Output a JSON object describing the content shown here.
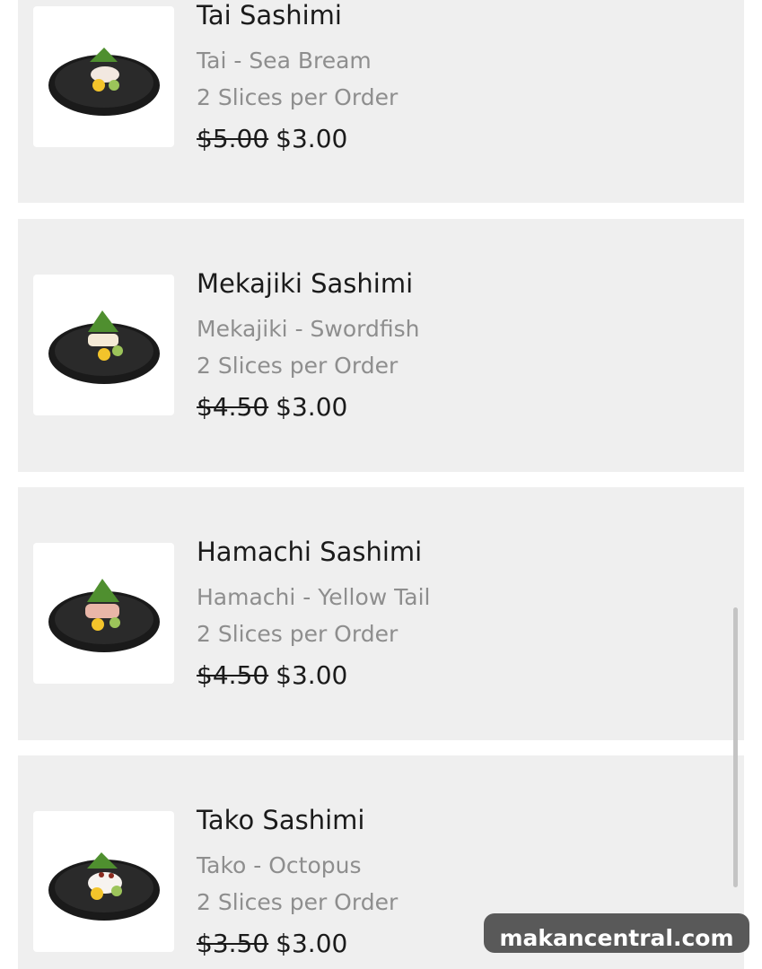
{
  "items": [
    {
      "name": "Tai Sashimi",
      "subtitle": "Tai - Sea Bream",
      "portion": "2 Slices per Order",
      "old_price": "$5.00",
      "new_price": "$3.00",
      "image_icon": "sashimi-plate-icon"
    },
    {
      "name": "Mekajiki Sashimi",
      "subtitle": "Mekajiki - Swordfish",
      "portion": "2 Slices per Order",
      "old_price": "$4.50",
      "new_price": "$3.00",
      "image_icon": "sashimi-plate-icon"
    },
    {
      "name": "Hamachi Sashimi",
      "subtitle": "Hamachi - Yellow Tail",
      "portion": "2 Slices per Order",
      "old_price": "$4.50",
      "new_price": "$3.00",
      "image_icon": "sashimi-plate-icon"
    },
    {
      "name": "Tako Sashimi",
      "subtitle": "Tako - Octopus",
      "portion": "2 Slices per Order",
      "old_price": "$3.50",
      "new_price": "$3.00",
      "image_icon": "sashimi-plate-icon"
    }
  ],
  "watermark": "makancentral.com",
  "colors": {
    "card_bg": "#efefef",
    "header_strip": "#efe3f1",
    "title_text": "#1b1b1b",
    "muted_text": "#8e8e8e",
    "watermark_bg": "#595959"
  }
}
